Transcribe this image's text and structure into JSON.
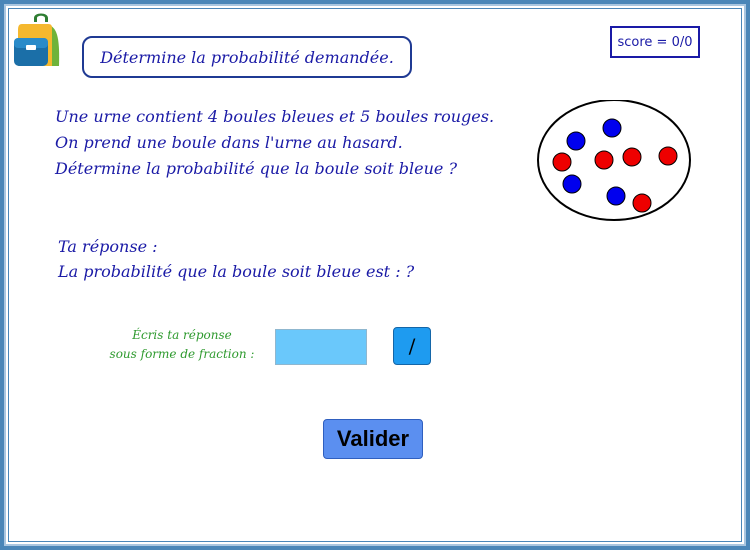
{
  "header": {
    "title": "Détermine la probabilité demandée.",
    "score": "score = 0/0",
    "logo_icon": "backpack-icon"
  },
  "question": {
    "line1": "Une urne contient 4 boules bleues et 5 boules rouges.",
    "line2": "On prend une boule dans l'urne au hasard.",
    "line3": "Détermine la probabilité que la boule soit bleue ?"
  },
  "urn": {
    "blue_count": 4,
    "red_count": 5,
    "blue_color": "#0000ee",
    "red_color": "#ee0000"
  },
  "answer": {
    "line1": "Ta réponse :",
    "line2": "La probabilité que la boule soit bleue est : ?"
  },
  "hint": {
    "line1": "Écris ta réponse",
    "line2": "sous forme de fraction :"
  },
  "input": {
    "value": ""
  },
  "buttons": {
    "fraction_label": "/",
    "validate_label": "Valider"
  },
  "colors": {
    "text": "#1a1aa6",
    "hint": "#2e9a2e",
    "input_bg": "#6ac8fb",
    "fraction_btn": "#1e9bf0",
    "validate_btn": "#5b8ff0"
  }
}
